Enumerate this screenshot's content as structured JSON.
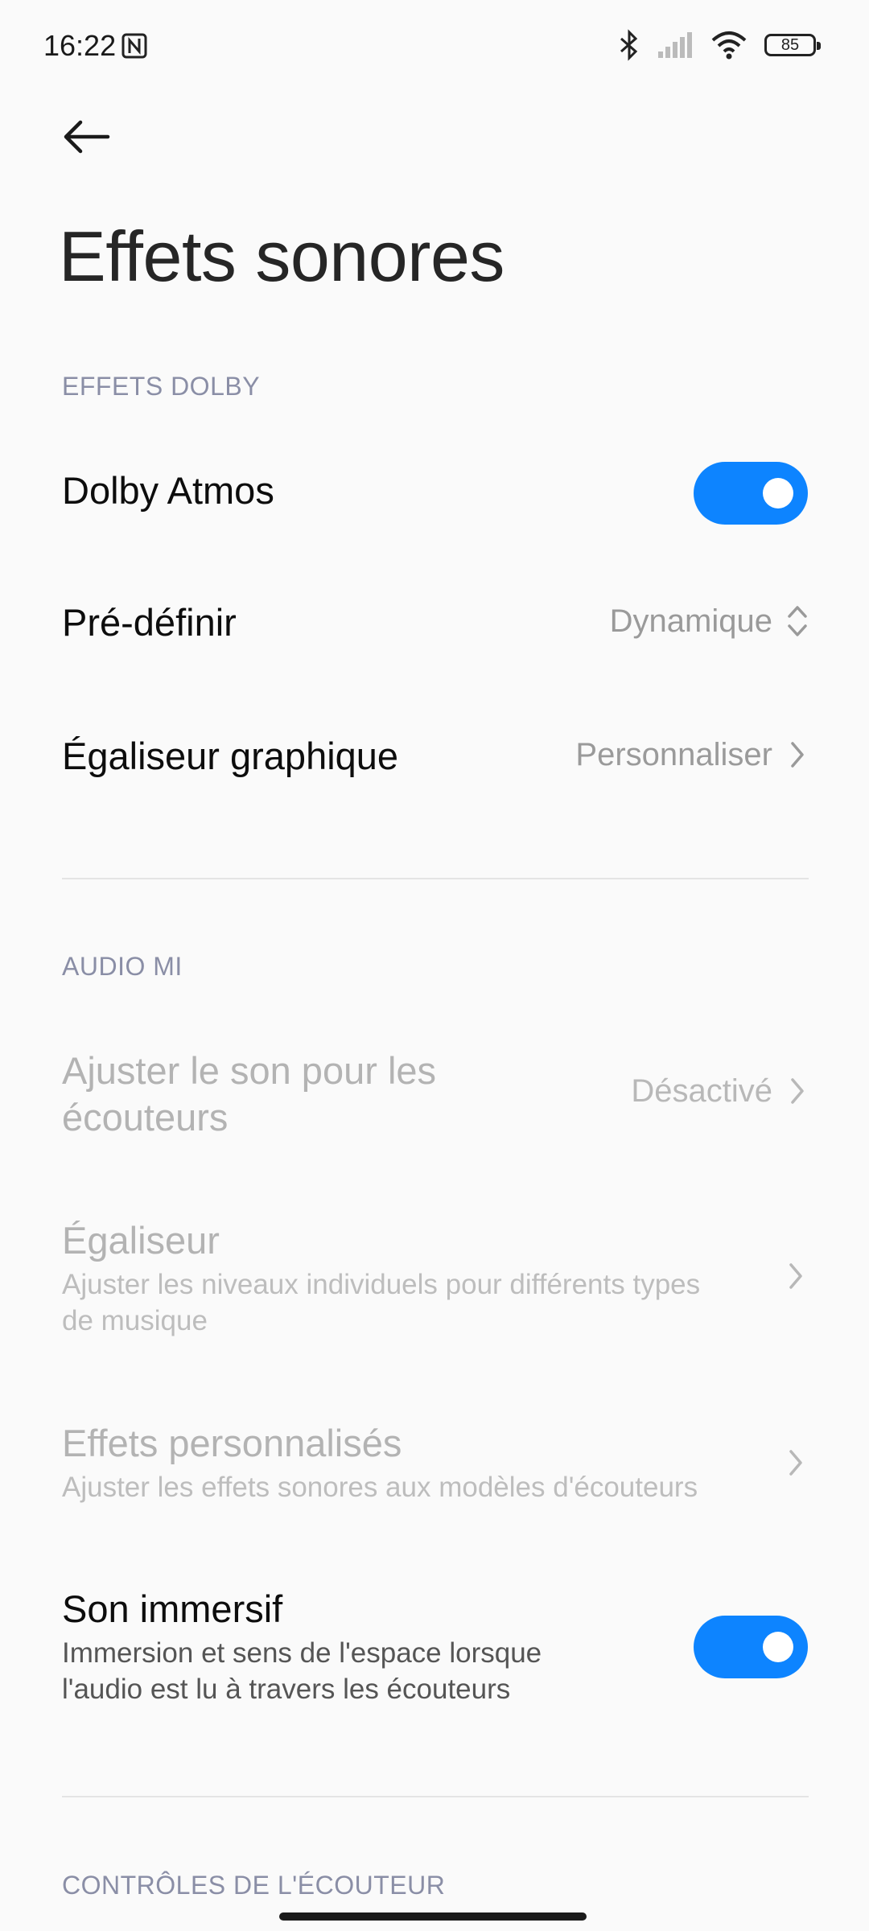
{
  "status_bar": {
    "time": "16:22",
    "battery": "85",
    "icons": [
      "nfc-icon",
      "bluetooth-icon",
      "signal-icon",
      "wifi-icon",
      "battery-icon"
    ]
  },
  "header": {
    "title": "Effets sonores"
  },
  "sections": {
    "dolby": {
      "header": "EFFETS DOLBY",
      "dolby_atmos": {
        "label": "Dolby Atmos",
        "enabled": true
      },
      "preset": {
        "label": "Pré-définir",
        "value": "Dynamique"
      },
      "graphic_eq": {
        "label": "Égaliseur graphique",
        "value": "Personnaliser"
      }
    },
    "audio_mi": {
      "header": "AUDIO MI",
      "adjust_headphones": {
        "label_line1": "Ajuster le son pour les",
        "label_line2": "écouteurs",
        "value": "Désactivé"
      },
      "equalizer": {
        "label": "Égaliseur",
        "sub_line1": "Ajuster les niveaux individuels pour différents types",
        "sub_line2": "de musique"
      },
      "custom_effects": {
        "label": "Effets personnalisés",
        "sub": "Ajuster les effets sonores aux modèles d'écouteurs"
      },
      "immersive": {
        "label": "Son immersif",
        "sub_line1": "Immersion et sens de l'espace lorsque",
        "sub_line2": "l'audio est lu à travers les écouteurs",
        "enabled": true
      }
    },
    "controls": {
      "header": "CONTRÔLES DE L'ÉCOUTEUR"
    }
  },
  "colors": {
    "accent": "#0d84ff",
    "section_header": "#8a8ea6",
    "disabled_text": "#b3b3b3",
    "background": "#fafafa"
  }
}
